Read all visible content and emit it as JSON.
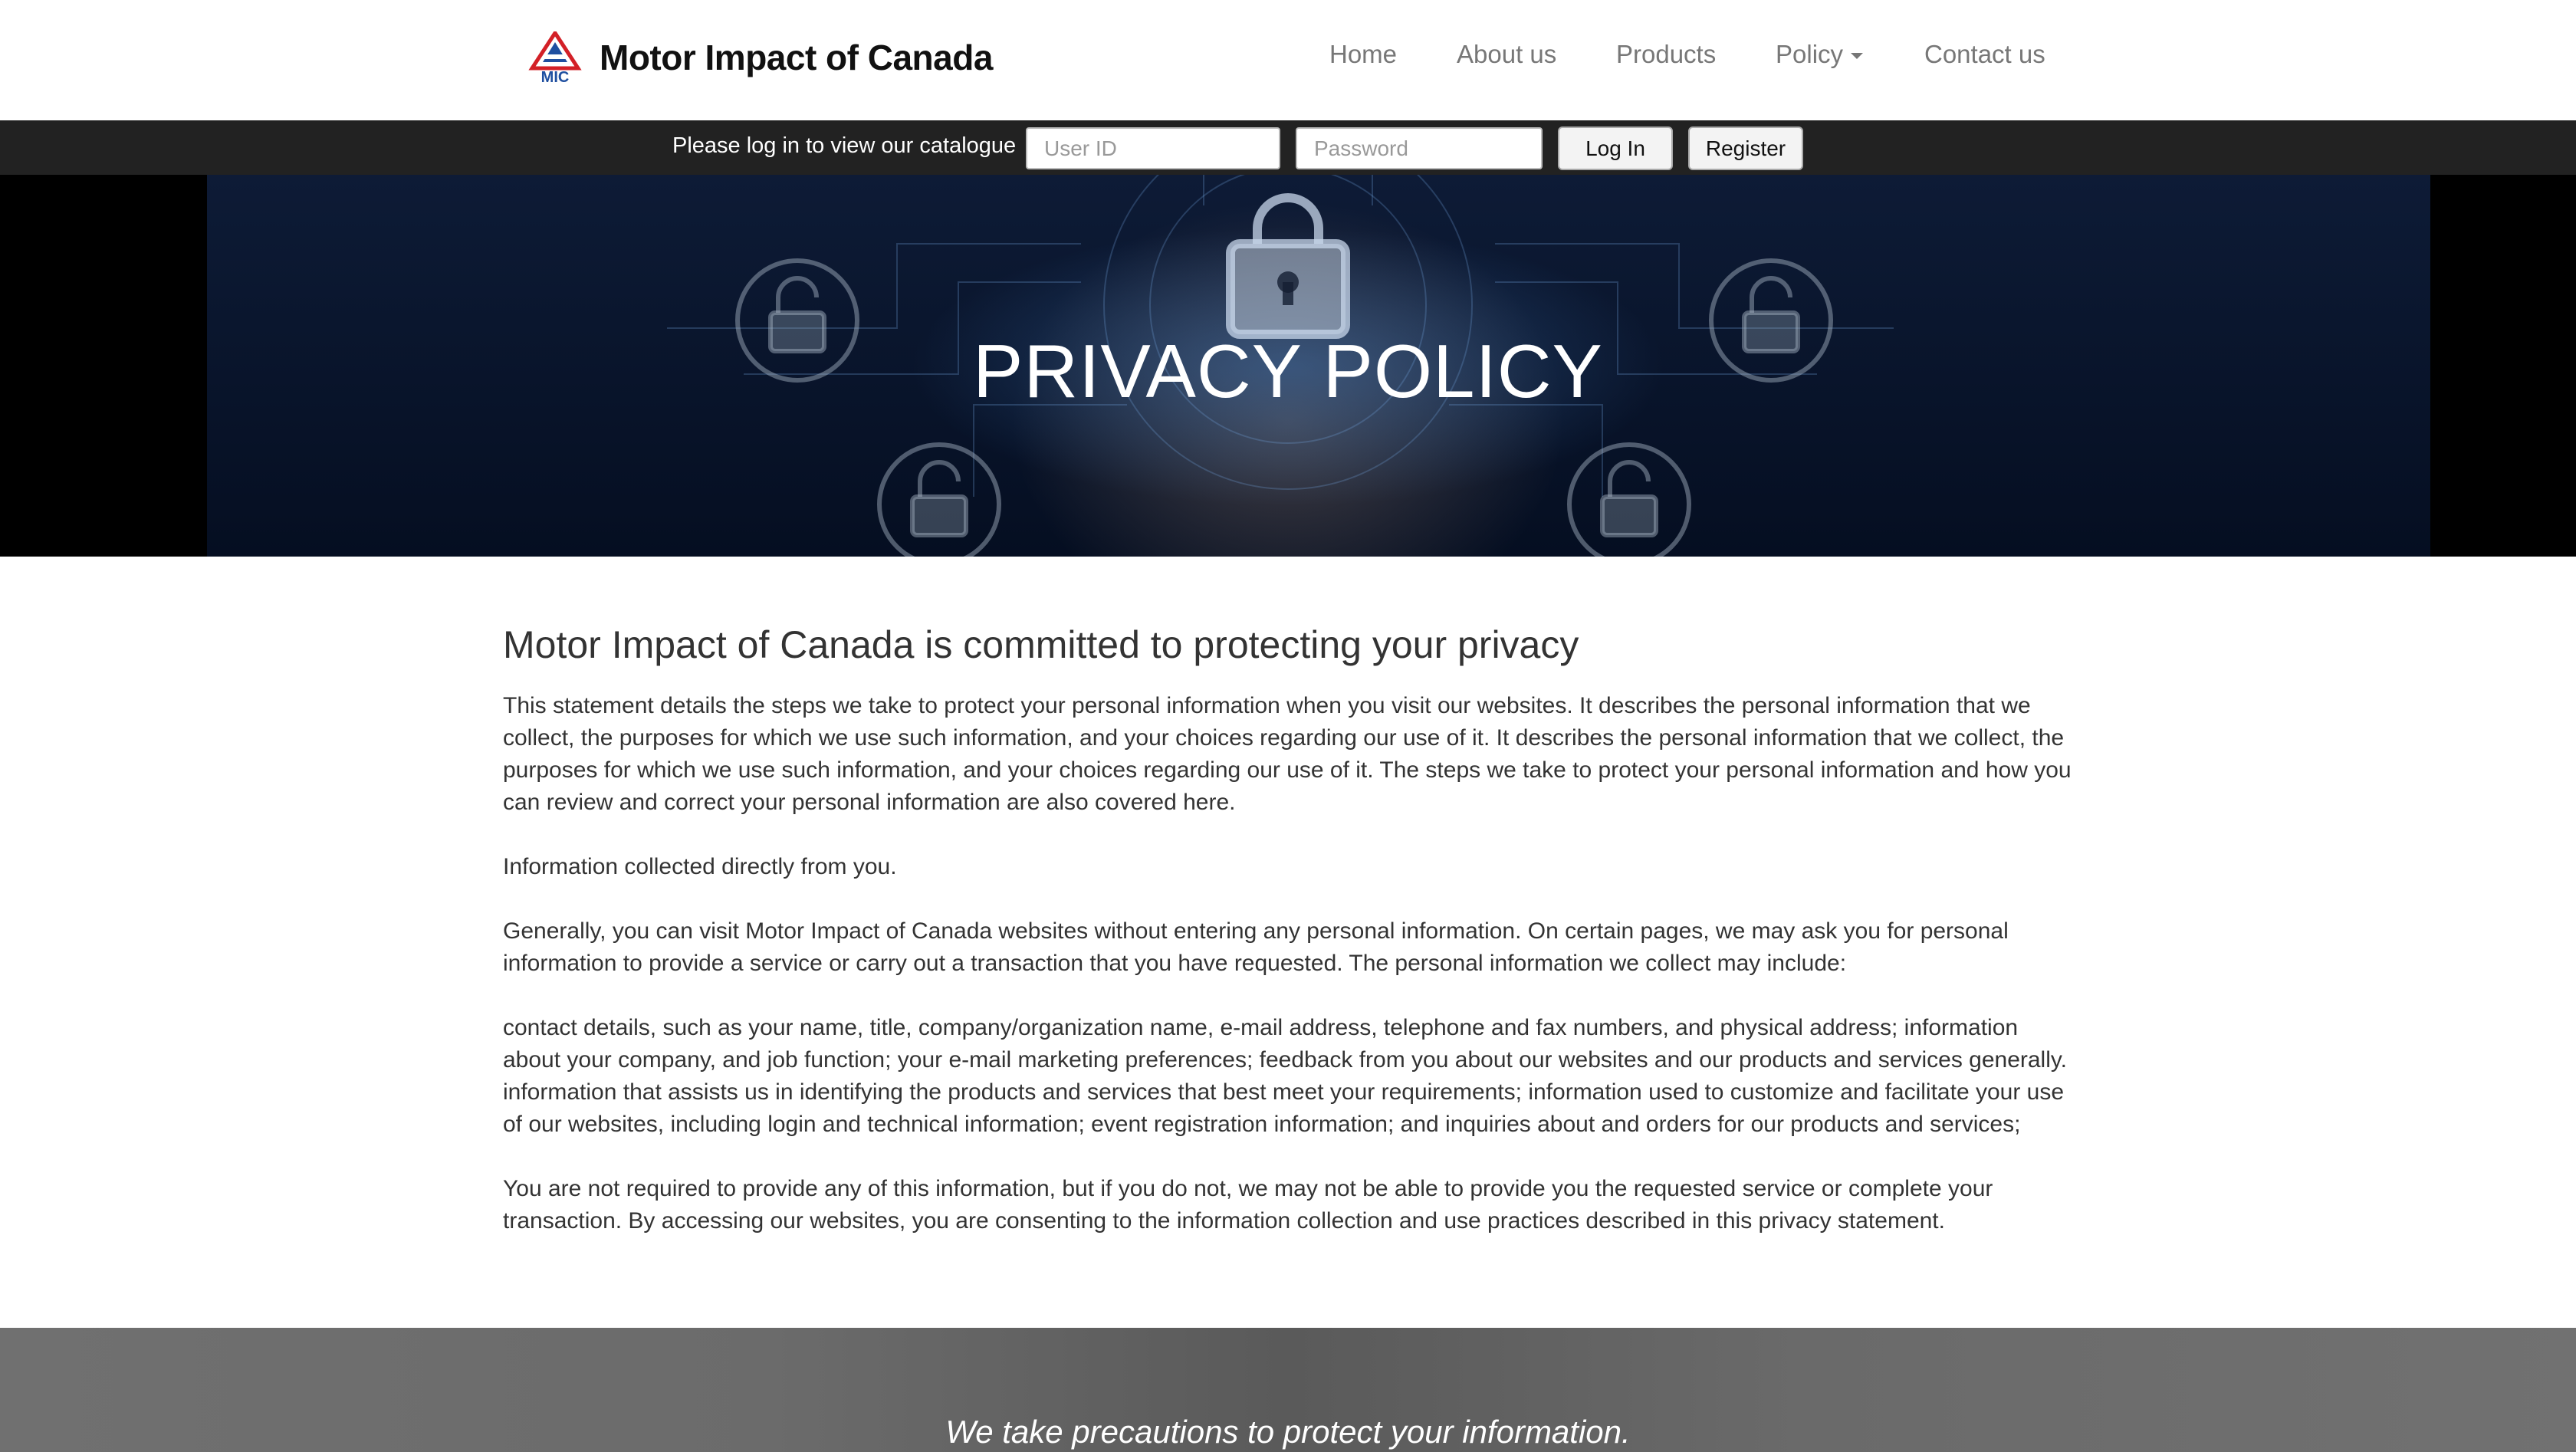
{
  "brand": {
    "logo_text": "MIC",
    "name": "Motor Impact of Canada"
  },
  "nav": {
    "items": [
      {
        "label": "Home"
      },
      {
        "label": "About us"
      },
      {
        "label": "Products"
      },
      {
        "label": "Policy"
      },
      {
        "label": "Contact us"
      }
    ]
  },
  "login": {
    "prompt": "Please log in to view our catalogue",
    "user_placeholder": "User ID",
    "password_placeholder": "Password",
    "login_label": "Log In",
    "register_label": "Register"
  },
  "hero": {
    "title": "PRIVACY POLICY"
  },
  "content": {
    "heading": "Motor Impact of Canada is committed to protecting your privacy",
    "paragraphs": [
      "This statement details the steps we take to protect your personal information when you visit our websites. It describes the personal information that we collect, the purposes for which we use such information, and your choices regarding our use of it. It describes the personal information that we collect, the purposes for which we use such information, and your choices regarding our use of it. The steps we take to protect your personal information and how you can review and correct your personal information are also covered here.",
      "Information collected directly from you.",
      "Generally, you can visit Motor Impact of Canada websites without entering any personal information. On certain pages, we may ask you for personal information to provide a service or carry out a transaction that you have requested. The personal information we collect may include:",
      "contact details, such as your name, title, company/organization name, e-mail address, telephone and fax numbers, and physical address; information about your company, and job function; your e-mail marketing preferences; feedback from you about our websites and our products and services generally. information that assists us in identifying the products and services that best meet your requirements; information used to customize and facilitate your use of our websites, including login and technical information; event registration information; and inquiries about and orders for our products and services;",
      "You are not required to provide any of this information, but if you do not, we may not be able to provide you the requested service or complete your transaction. By accessing our websites, you are consenting to the information collection and use practices described in this privacy statement."
    ]
  },
  "band": {
    "text": "We take precautions to protect your information."
  },
  "colors": {
    "login_bar": "#222222",
    "nav_text": "#777777",
    "logo_red": "#d32027",
    "logo_blue": "#1f4fa0"
  },
  "icons": [
    "padlock-icon",
    "caret-down-icon"
  ]
}
